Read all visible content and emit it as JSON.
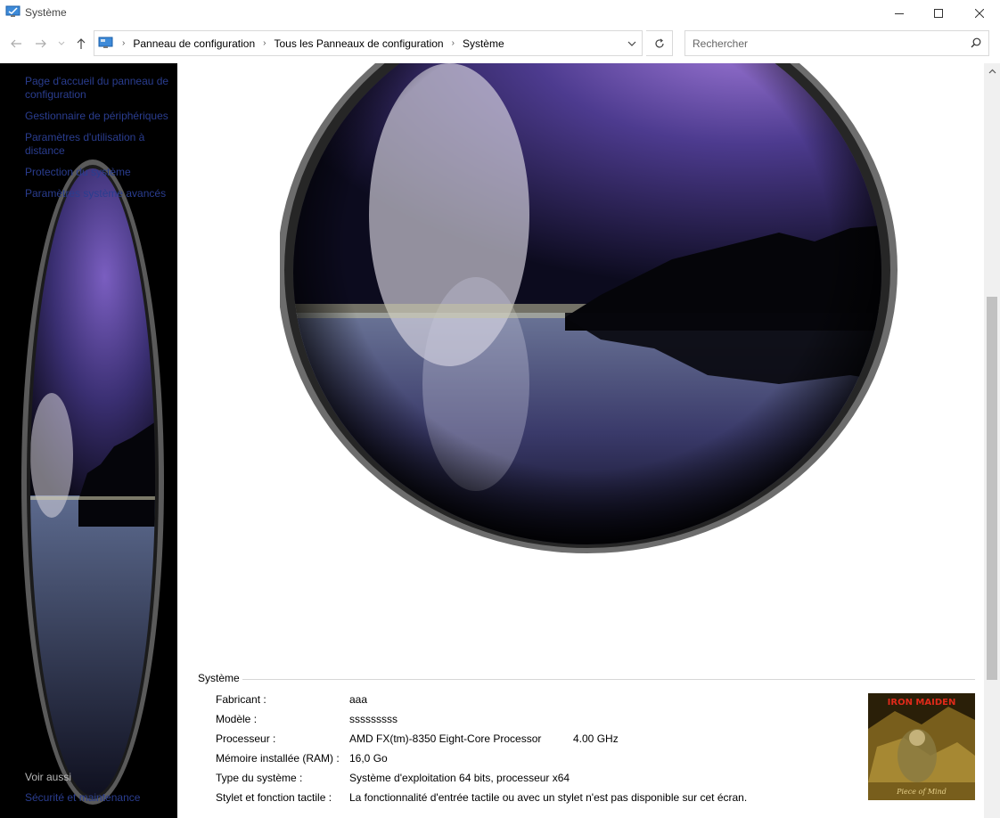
{
  "window": {
    "title": "Système",
    "controls": {
      "minimize": "minimize-icon",
      "maximize": "maximize-icon",
      "close": "close-icon"
    }
  },
  "nav": {
    "breadcrumbs": [
      "Panneau de configuration",
      "Tous les Panneaux de configuration",
      "Système"
    ],
    "search_placeholder": "Rechercher"
  },
  "sidebar": {
    "tasks": [
      {
        "label": "Page d'accueil du panneau de configuration"
      },
      {
        "label": "Gestionnaire de périphériques"
      },
      {
        "label": "Paramètres d'utilisation à distance"
      },
      {
        "label": "Protection du système"
      },
      {
        "label": "Paramètres système avancés"
      }
    ],
    "see_also_title": "Voir aussi",
    "see_also_link": "Sécurité et maintenance"
  },
  "system": {
    "section_title": "Système",
    "rows": [
      {
        "key": "Fabricant :",
        "value": "aaa",
        "extra": ""
      },
      {
        "key": "Modèle :",
        "value": "sssssssss",
        "extra": ""
      },
      {
        "key": "Processeur :",
        "value": "AMD FX(tm)-8350 Eight-Core Processor",
        "extra": "4.00 GHz"
      },
      {
        "key": "Mémoire installée (RAM) :",
        "value": "16,0 Go",
        "extra": ""
      },
      {
        "key": "Type du système :",
        "value": "Système d'exploitation 64 bits, processeur x64",
        "extra": ""
      },
      {
        "key": "Stylet et fonction tactile :",
        "value": "La fonctionnalité d'entrée tactile ou avec un stylet n'est pas disponible sur cet écran.",
        "extra": ""
      }
    ],
    "album_title": "IRON MAIDEN",
    "album_subtitle": "Piece of Mind"
  },
  "colors": {
    "link": "#2a3d8f",
    "sidebar_bg": "#000000",
    "scroll_thumb": "#c1c1c1"
  }
}
